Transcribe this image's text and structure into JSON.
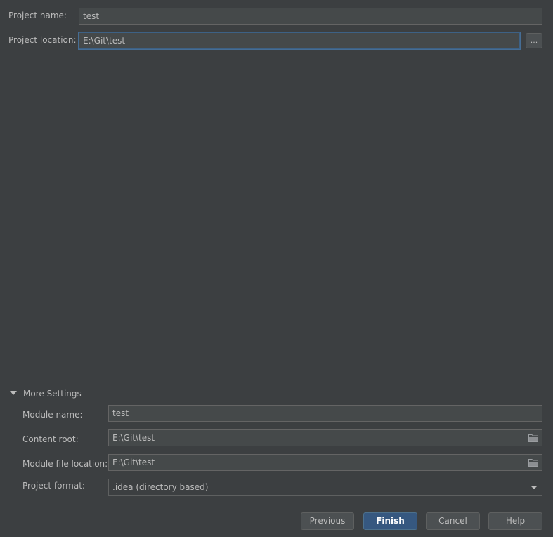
{
  "project": {
    "name_label": "Project name:",
    "name_value": "test",
    "location_label": "Project location:",
    "location_value": "E:\\Git\\test",
    "browse_label": "..."
  },
  "more_settings": {
    "title": "More Settings",
    "expanded": true,
    "module_name_label": "Module name:",
    "module_name_value": "test",
    "content_root_label": "Content root:",
    "content_root_value": "E:\\Git\\test",
    "module_file_label": "Module file location:",
    "module_file_value": "E:\\Git\\test",
    "project_format_label": "Project format:",
    "project_format_value": ".idea (directory based)"
  },
  "buttons": {
    "previous": "Previous",
    "finish": "Finish",
    "cancel": "Cancel",
    "help": "Help"
  },
  "colors": {
    "background": "#3c3f41",
    "field": "#45494a",
    "primary_button": "#365880",
    "focus_border": "#466d94"
  },
  "icons": {
    "browse_folder": "folder-icon",
    "section_toggle": "triangle-down-icon",
    "dropdown": "chevron-down-icon"
  }
}
